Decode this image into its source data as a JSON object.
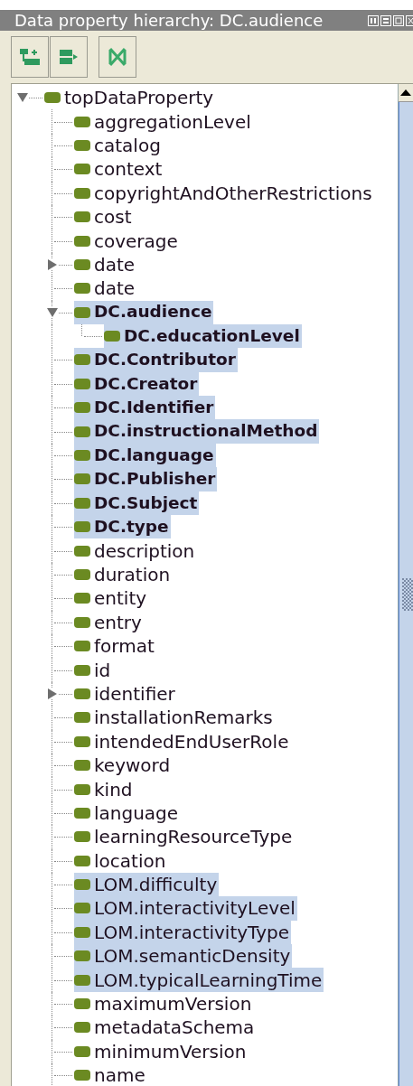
{
  "window": {
    "title": "Data property hierarchy: DC.audience"
  },
  "tree": [
    {
      "label": "topDataProperty",
      "bold": false,
      "selected": false,
      "expanded": true,
      "children": [
        {
          "label": "aggregationLevel",
          "bold": false,
          "selected": false
        },
        {
          "label": "catalog",
          "bold": false,
          "selected": false
        },
        {
          "label": "context",
          "bold": false,
          "selected": false
        },
        {
          "label": "copyrightAndOtherRestrictions",
          "bold": false,
          "selected": false
        },
        {
          "label": "cost",
          "bold": false,
          "selected": false
        },
        {
          "label": "coverage",
          "bold": false,
          "selected": false
        },
        {
          "label": "date",
          "bold": false,
          "selected": false,
          "expanded": false
        },
        {
          "label": "date",
          "bold": false,
          "selected": false
        },
        {
          "label": "DC.audience",
          "bold": true,
          "selected": true,
          "expanded": true,
          "children": [
            {
              "label": "DC.educationLevel",
              "bold": true,
              "selected": true
            }
          ]
        },
        {
          "label": "DC.Contributor",
          "bold": true,
          "selected": true
        },
        {
          "label": "DC.Creator",
          "bold": true,
          "selected": true
        },
        {
          "label": "DC.Identifier",
          "bold": true,
          "selected": true
        },
        {
          "label": "DC.instructionalMethod",
          "bold": true,
          "selected": true
        },
        {
          "label": "DC.language",
          "bold": true,
          "selected": true
        },
        {
          "label": "DC.Publisher",
          "bold": true,
          "selected": true
        },
        {
          "label": "DC.Subject",
          "bold": true,
          "selected": true
        },
        {
          "label": "DC.type",
          "bold": true,
          "selected": true
        },
        {
          "label": "description",
          "bold": false,
          "selected": false
        },
        {
          "label": "duration",
          "bold": false,
          "selected": false
        },
        {
          "label": "entity",
          "bold": false,
          "selected": false
        },
        {
          "label": "entry",
          "bold": false,
          "selected": false
        },
        {
          "label": "format",
          "bold": false,
          "selected": false
        },
        {
          "label": "id",
          "bold": false,
          "selected": false
        },
        {
          "label": "identifier",
          "bold": false,
          "selected": false,
          "expanded": false
        },
        {
          "label": "installationRemarks",
          "bold": false,
          "selected": false
        },
        {
          "label": "intendedEndUserRole",
          "bold": false,
          "selected": false
        },
        {
          "label": "keyword",
          "bold": false,
          "selected": false
        },
        {
          "label": "kind",
          "bold": false,
          "selected": false
        },
        {
          "label": "language",
          "bold": false,
          "selected": false
        },
        {
          "label": "learningResourceType",
          "bold": false,
          "selected": false
        },
        {
          "label": "location",
          "bold": false,
          "selected": false
        },
        {
          "label": "LOM.difficulty",
          "bold": false,
          "selected": true
        },
        {
          "label": "LOM.interactivityLevel",
          "bold": false,
          "selected": true
        },
        {
          "label": "LOM.interactivityType",
          "bold": false,
          "selected": true
        },
        {
          "label": "LOM.semanticDensity",
          "bold": false,
          "selected": true
        },
        {
          "label": "LOM.typicalLearningTime",
          "bold": false,
          "selected": true
        },
        {
          "label": "maximumVersion",
          "bold": false,
          "selected": false
        },
        {
          "label": "metadataSchema",
          "bold": false,
          "selected": false
        },
        {
          "label": "minimumVersion",
          "bold": false,
          "selected": false
        },
        {
          "label": "name",
          "bold": false,
          "selected": false
        }
      ]
    }
  ]
}
